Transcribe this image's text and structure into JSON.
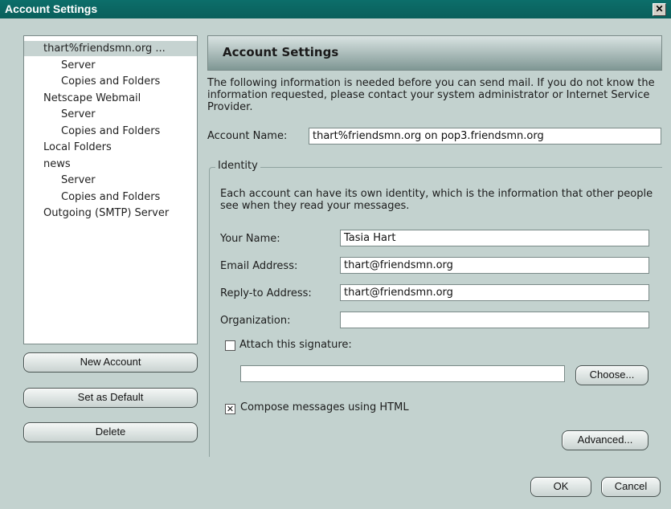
{
  "window": {
    "title": "Account Settings",
    "close_glyph": "✕"
  },
  "tree": {
    "items": [
      {
        "label": "thart%friendsmn.org ...",
        "level": 0,
        "selected": true
      },
      {
        "label": "Server",
        "level": 1
      },
      {
        "label": "Copies and Folders",
        "level": 1
      },
      {
        "label": "Netscape Webmail",
        "level": 0
      },
      {
        "label": "Server",
        "level": 1
      },
      {
        "label": "Copies and Folders",
        "level": 1
      },
      {
        "label": "Local Folders",
        "level": 0
      },
      {
        "label": "news",
        "level": 0
      },
      {
        "label": "Server",
        "level": 1
      },
      {
        "label": "Copies and Folders",
        "level": 1
      },
      {
        "label": "Outgoing (SMTP) Server",
        "level": 0
      }
    ]
  },
  "left_buttons": {
    "new_account": "New Account",
    "set_default": "Set as Default",
    "delete": "Delete"
  },
  "panel": {
    "title": "Account Settings",
    "intro": "The following information is needed before you can send mail. If you do not know the information requested, please contact your system administrator or Internet Service Provider.",
    "account_name_label": "Account Name:",
    "account_name_value": "thart%friendsmn.org on pop3.friendsmn.org"
  },
  "identity": {
    "legend": "Identity",
    "description": "Each account can have its own identity, which is the information that other people see when they read your messages.",
    "your_name_label": "Your Name:",
    "your_name_value": "Tasia Hart",
    "email_label": "Email Address:",
    "email_value": "thart@friendsmn.org",
    "reply_to_label": "Reply-to Address:",
    "reply_to_value": "thart@friendsmn.org",
    "organization_label": "Organization:",
    "organization_value": "",
    "attach_signature_label": "Attach this signature:",
    "attach_signature_checked": false,
    "signature_path": "",
    "choose_button": "Choose...",
    "compose_html_label": "Compose messages using HTML",
    "compose_html_checked": true,
    "check_glyph": "✕",
    "advanced_button": "Advanced..."
  },
  "footer": {
    "ok": "OK",
    "cancel": "Cancel"
  }
}
